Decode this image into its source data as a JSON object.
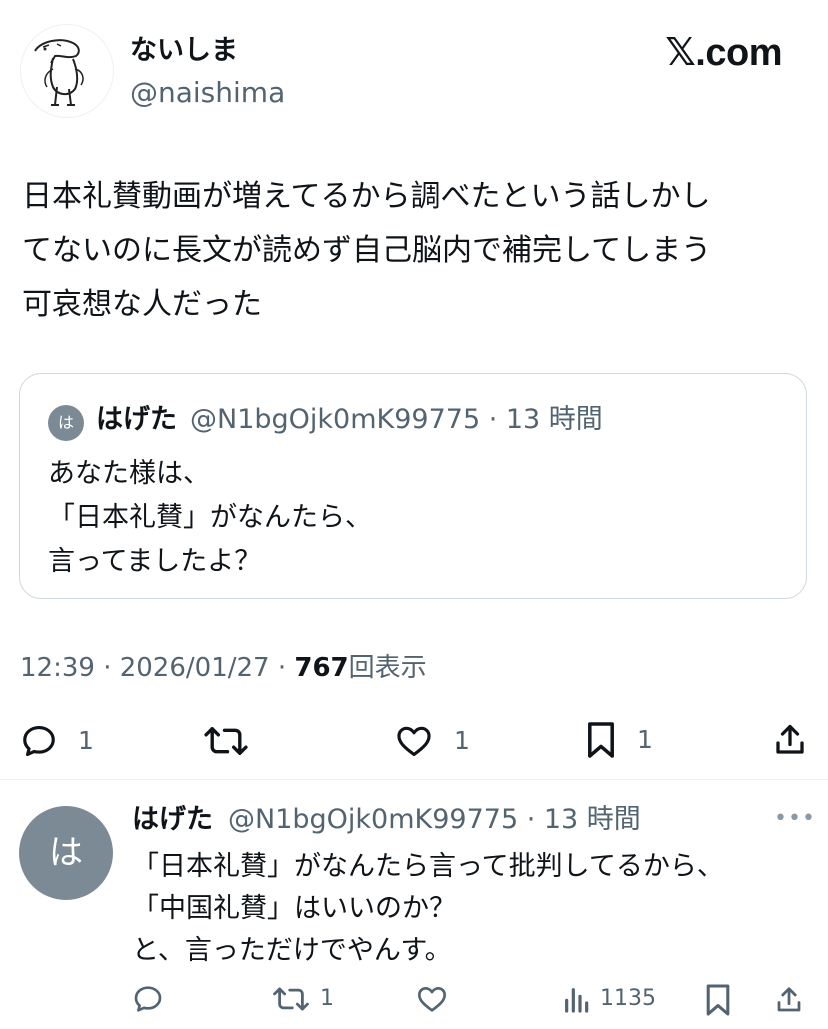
{
  "header": {
    "author_name": "ないしま",
    "author_handle": "@naishima",
    "site_label": "𝕏.com"
  },
  "post": {
    "text": "日本礼賛動画が増えてるから調べたという話しかし\nてないのに長文が読めず自己脳内で補完してしまう\n可哀想な人だった"
  },
  "quote": {
    "avatar_char": "は",
    "author_name": "はげた",
    "meta": "@N1bgOjk0mK99775 · 13 時間",
    "text": "あなた様は、\n「日本礼賛」がなんたら、\n言ってましたよ？"
  },
  "meta": {
    "time_date": "12:39 · 2026/01/27 · ",
    "views_count": "767",
    "views_label": "回表示"
  },
  "actions": {
    "reply_count": "1",
    "like_count": "1",
    "bookmark_count": "1"
  },
  "reply": {
    "avatar_char": "は",
    "author_name": "はげた",
    "meta": "@N1bgOjk0mK99775 · 13 時間",
    "more": "•••",
    "text": "「日本礼賛」がなんたら言って批判してるから、\n「中国礼賛」はいいのか？\nと、言っただけでやんす。",
    "retweet_count": "1",
    "views_count": "1135"
  },
  "colors": {
    "text": "#0f1419",
    "secondary": "#536471",
    "border": "#cfd9de",
    "avatar_gray": "#7c8a96"
  }
}
